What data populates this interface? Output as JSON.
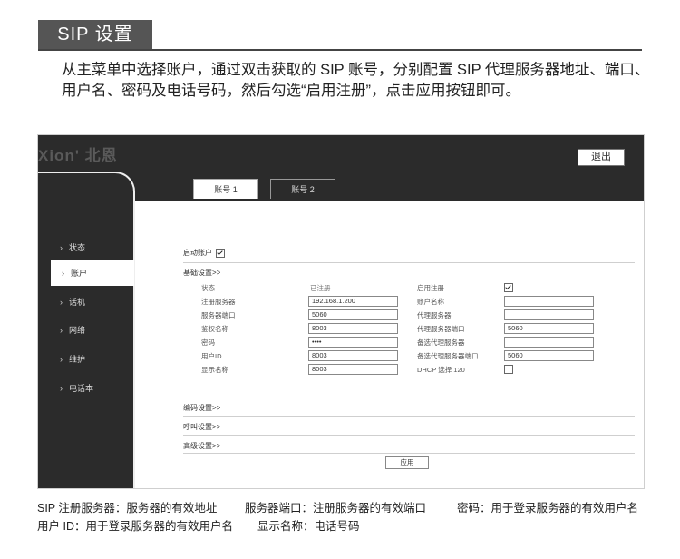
{
  "section": {
    "title": "SIP 设置"
  },
  "intro": "从主菜单中选择账户，通过双击获取的 SIP 账号，分别配置 SIP 代理服务器地址、端口、用户名、密码及电话号码，然后勾选“启用注册”，点击应用按钮即可。",
  "app": {
    "logo": "Xion' 北恩",
    "logout_label": "退出",
    "nav": [
      {
        "label": "状态",
        "active": false
      },
      {
        "label": "账户",
        "active": true
      },
      {
        "label": "话机",
        "active": false
      },
      {
        "label": "网络",
        "active": false
      },
      {
        "label": "维护",
        "active": false
      },
      {
        "label": "电话本",
        "active": false
      }
    ],
    "tabs": [
      {
        "label": "账号 1"
      },
      {
        "label": "账号 2"
      }
    ],
    "enable_account": {
      "label": "启动账户",
      "checked": true
    },
    "basic_settings_title": "基础设置>>",
    "left_fields": [
      {
        "label": "状态",
        "value": "已注册"
      },
      {
        "label": "注册服务器",
        "value": "192.168.1.200"
      },
      {
        "label": "服务器端口",
        "value": "5060"
      },
      {
        "label": "鉴权名称",
        "value": "8003"
      },
      {
        "label": "密码",
        "value": "••••"
      },
      {
        "label": "用户ID",
        "value": "8003"
      },
      {
        "label": "显示名称",
        "value": "8003"
      }
    ],
    "right_fields": [
      {
        "label": "启用注册",
        "type": "checkbox",
        "checked": true
      },
      {
        "label": "账户名称",
        "value": ""
      },
      {
        "label": "代理服务器",
        "value": ""
      },
      {
        "label": "代理服务器端口",
        "value": "5060"
      },
      {
        "label": "备选代理服务器",
        "value": ""
      },
      {
        "label": "备选代理服务器端口",
        "value": "5060"
      },
      {
        "label": "DHCP 选择 120",
        "type": "checkbox",
        "checked": false
      }
    ],
    "codec_settings_title": "编码设置>>",
    "call_settings_title": "呼叫设置>>",
    "advanced_settings_title": "高级设置>>",
    "apply_label": "应用"
  },
  "footer": {
    "line1": [
      "SIP 注册服务器：服务器的有效地址",
      "服务器端口：注册服务器的有效端口",
      "密码：用于登录服务器的有效用户名"
    ],
    "line2": [
      "用户 ID：用于登录服务器的有效用户名",
      "显示名称：电话号码"
    ]
  }
}
